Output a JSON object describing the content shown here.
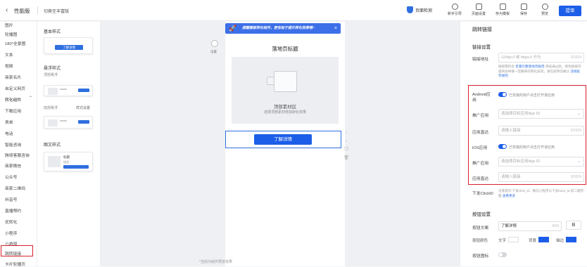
{
  "topbar": {
    "back_icon": "chevron-left-icon",
    "title": "性能版",
    "switch_label": "切换至丰富版",
    "detect_label": "页面检测",
    "tools": [
      {
        "label": "新手引导",
        "icon": "help-circle-icon"
      },
      {
        "label": "页面设置",
        "icon": "settings-icon"
      },
      {
        "label": "存为模板",
        "icon": "template-icon"
      },
      {
        "label": "保存",
        "icon": "save-icon"
      },
      {
        "label": "预览",
        "icon": "eye-icon"
      }
    ],
    "publish_label": "提审"
  },
  "leftnav": {
    "items": [
      "图片",
      "轮播图",
      "180°全景图",
      "文本",
      "视频",
      "商家名片",
      "自定义网页",
      "转化组件",
      "下载应用",
      "表单",
      "电话",
      "智能咨询",
      "跨境客服咨询",
      "商家微信",
      "公众号",
      "商家二维码",
      "抖音号",
      "直播预约",
      "优转化",
      "小程序",
      "小游戏",
      "跳转链接",
      "卡片轮播页"
    ],
    "group_item": "转化组件",
    "highlight_item": "跳转链接"
  },
  "components": {
    "basic_title": "基本样式",
    "basic_btn": "了解详情",
    "float_title": "悬浮样式",
    "top_float": "顶部悬浮",
    "bottom_float": "底部悬浮",
    "bottom_opt": "样式设置",
    "img_title": "图文样式",
    "mini_title": "标题",
    "mini_text": "描述"
  },
  "canvas": {
    "settings_label": "设置",
    "banner_text": "提醒模板转化组件，更有助于提升转化效果哦~",
    "page_title": "落地页标题",
    "material_title": "顶部素材区",
    "material_sub": "选择顶部素材增加转化效果",
    "cta_label": "了解详情",
    "bottom_note": "*当前为组件预览效果"
  },
  "panel": {
    "title": "跳转链接",
    "link_section": "链接设置",
    "link_label": "链接地址",
    "link_placeholder": "以http:// 或 https:// 开头",
    "link_count": "0/1024",
    "link_hint_a": "链接需符合",
    "link_hint_link1": "巨量引擎落地页规范",
    "link_hint_b": "审核通过后，修改链接内容将会导致一定概率的转化异常，请在提审前确认",
    "link_hint_link2": "违规处罚规则",
    "android_label": "Android应用",
    "android_toggle_text": "已安装的用户点击打开该应用",
    "promote_label": "推广应用",
    "promote_placeholder": "请选择目标应用App ID",
    "direct_label": "应用直达",
    "direct_placeholder": "请输入链接",
    "direct_count": "0/1024",
    "ios_label": "iOS应用",
    "ios_toggle_text": "已安装的用户点击打开该应用",
    "promote_label_ios": "推广应用",
    "promote_placeholder_ios": "请选择目标应用App ID",
    "direct_label_ios": "应用直达",
    "direct_placeholder_ios": "请输入链接",
    "direct_count_ios": "0/1024",
    "clickid_label": "下发ClickID",
    "clickid_text": "注意提示:下发click_id、微信小程序以下会trace_id 前二跳页面",
    "clickid_link": "查看更多",
    "button_section": "按钮设置",
    "button_text_label": "按钮文案",
    "button_text_value": "了解详情",
    "button_text_count": "4/10",
    "bold_label": "B",
    "button_color_label": "按钮颜色",
    "color_text": "文字",
    "color_bg": "背景",
    "color_border": "描边",
    "button_icon_label": "按钮图标"
  },
  "colors": {
    "primary": "#1c5ee8",
    "highlight_red": "#d9202b"
  }
}
